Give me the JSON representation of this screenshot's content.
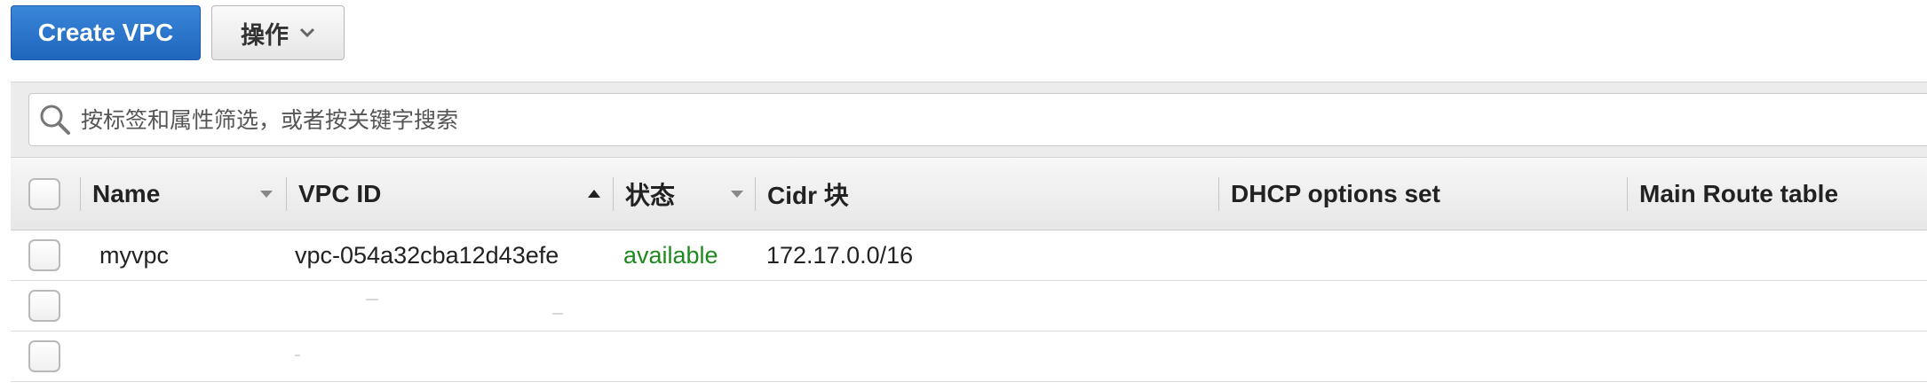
{
  "toolbar": {
    "create_label": "Create VPC",
    "actions_label": "操作"
  },
  "filter": {
    "placeholder": "按标签和属性筛选，或者按关键字搜索"
  },
  "table": {
    "columns": [
      {
        "key": "name",
        "label": "Name"
      },
      {
        "key": "vpc_id",
        "label": "VPC ID"
      },
      {
        "key": "state",
        "label": "状态"
      },
      {
        "key": "cidr",
        "label": "Cidr 块"
      },
      {
        "key": "dhcp",
        "label": "DHCP options set"
      },
      {
        "key": "route",
        "label": "Main Route table"
      }
    ],
    "rows": [
      {
        "name": "myvpc",
        "vpc_id": "vpc-054a32cba12d43efe",
        "state": "available",
        "cidr": "172.17.0.0/16",
        "dhcp": "",
        "route": ""
      },
      {
        "name": "",
        "vpc_id": "",
        "state": "",
        "cidr": "",
        "dhcp": "",
        "route": ""
      },
      {
        "name": "",
        "vpc_id": "",
        "state": "",
        "cidr": "",
        "dhcp": "",
        "route": ""
      }
    ]
  },
  "colors": {
    "primary": "#1f66bd",
    "available": "#1e8a1e"
  },
  "icons": {
    "search": "search-icon",
    "dropdown": "chevron-down-icon"
  }
}
